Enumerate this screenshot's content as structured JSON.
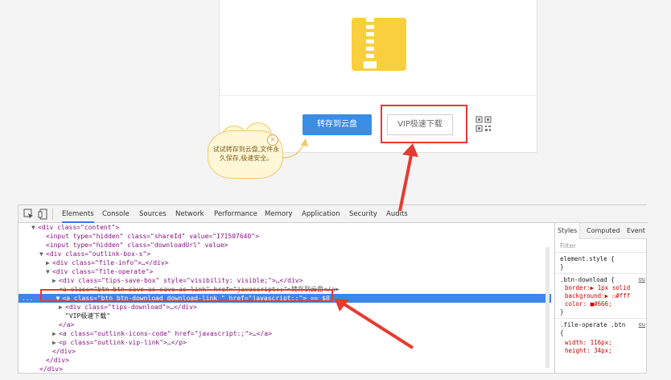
{
  "page": {
    "save_button": "转存到云盘",
    "vip_button": "VIP极速下载",
    "tooltip_text": "试试转存到云盘,文件永久保存,极速安全。",
    "tooltip_close": "×"
  },
  "devtools": {
    "tabs": [
      "Elements",
      "Console",
      "Sources",
      "Network",
      "Performance",
      "Memory",
      "Application",
      "Security",
      "Audits"
    ],
    "active_tab": "Elements",
    "styles_tabs": [
      "Styles",
      "Computed",
      "Event"
    ],
    "filter_placeholder": "Filter",
    "styles": {
      "element_style": "element.style {",
      "close_brace": "}",
      "btn_download_selector": ".btn-download {",
      "btn_download_source": "ou",
      "border": "border:▶ 1px solid",
      "background": "background:▶ ☐#fff",
      "color": "color: ■#666;",
      "file_operate_selector": ".file-operate .btn",
      "file_operate_source": "ou",
      "brace_open": "{",
      "width": "width: 116px;",
      "height": "height: 34px;"
    },
    "selected_line_marker": "...",
    "code": {
      "l1_tag": "<div class=\"content\">",
      "l2": "<input type=\"hidden\" class=\"shareId\" value=\"171507640\">",
      "l3": "<input type=\"hidden\" class=\"downloadUrl\" value>",
      "l4": "<div class=\"outlink-box-s\">",
      "l5": "<div class=\"file-info\">…</div>",
      "l6": "<div class=\"file-operate\">",
      "l7": "<div class=\"tips-save-box\" style=\"visibility: visible;\">…</div>",
      "l8": "<a class=\"btn btn-save-as save-as-link\" href=\"javascript:;\">转存到云盘</a>",
      "l9": "<a class=\"btn btn-download download-link \" href=\"javascript:;\"> == $0",
      "l10": "<div class=\"tips-download\">…</div>",
      "l11": "\"VIP极速下载\"",
      "l12": "</a>",
      "l13": "<a class=\"outlink-icons-code\" href=\"javascript:;\">…</a>",
      "l14": "<p class=\"outlink-vip-link\">…</p>",
      "l15": "</div>",
      "l16": "</div>",
      "l17": "</div>"
    }
  },
  "colors": {
    "accent_blue": "#3b8ce3",
    "highlight_red": "#e53b30",
    "zip_yellow": "#f9cf3e",
    "selection_blue": "#3e85e8"
  },
  "icons": [
    "zip-file-icon",
    "qr-code-icon",
    "inspect-element-icon",
    "device-toolbar-icon",
    "close-icon"
  ]
}
